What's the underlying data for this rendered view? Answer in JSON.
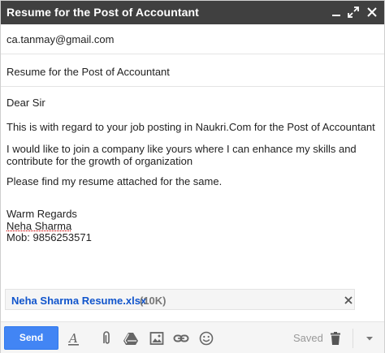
{
  "titlebar": {
    "title": "Resume for the Post of Accountant",
    "minimize_icon": "minimize-icon",
    "expand_icon": "expand-icon",
    "close_icon": "close-icon"
  },
  "compose": {
    "to": "ca.tanmay@gmail.com",
    "subject": "Resume for the Post of Accountant"
  },
  "body": {
    "greeting": "Dear Sir",
    "line1": "This is with regard to your job posting in Naukri.Com for the Post of Accountant",
    "line2": "I would like to join a company like yours where I can enhance my skills and contribute for the growth of organization",
    "line3": "Please find my resume attached for the same.",
    "sign_off": "Warm Regards",
    "name": "Neha Sharma",
    "mobile": "Mob: 9856253571"
  },
  "attachment": {
    "filename": "Neha Sharma Resume.xlsx",
    "size": "(10K)"
  },
  "toolbar": {
    "send_label": "Send",
    "saved_label": "Saved",
    "icons": [
      "format-text-icon",
      "paperclip-icon",
      "drive-icon",
      "photo-icon",
      "link-icon",
      "emoji-icon",
      "trash-icon",
      "more-options-icon"
    ]
  },
  "colors": {
    "titlebar_bg": "#404040",
    "send_button": "#4285f4",
    "attachment_link": "#1155cc"
  }
}
